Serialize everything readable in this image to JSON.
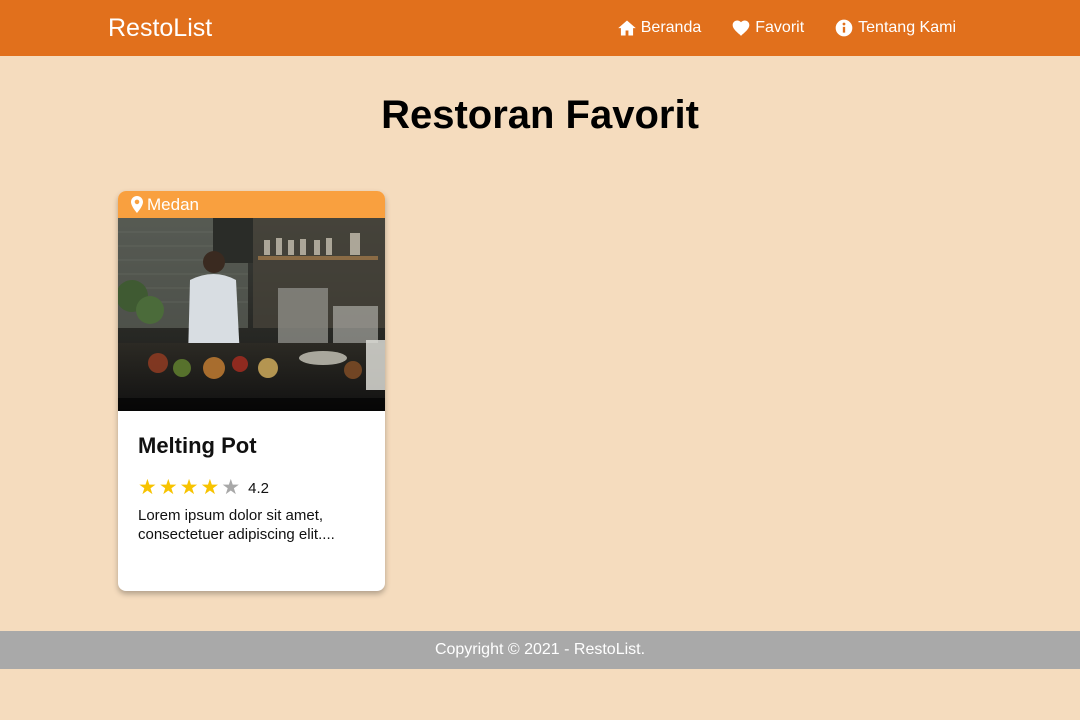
{
  "header": {
    "brand": "RestoList",
    "nav": [
      {
        "label": "Beranda",
        "icon": "home-icon"
      },
      {
        "label": "Favorit",
        "icon": "heart-icon"
      },
      {
        "label": "Tentang Kami",
        "icon": "info-icon"
      }
    ]
  },
  "main": {
    "title": "Restoran Favorit",
    "restaurants": [
      {
        "city": "Medan",
        "name": "Melting Pot",
        "rating": 4.2,
        "rating_text": "4.2",
        "stars_filled": 4,
        "stars_total": 5,
        "description": "Lorem ipsum dolor sit amet, consectetuer adipiscing elit...."
      }
    ]
  },
  "footer": {
    "copyright": "Copyright © 2021 - RestoList."
  },
  "colors": {
    "header_bg": "#e1701c",
    "page_bg": "#f5dcbe",
    "city_tag_bg": "#f9a03f",
    "star_on": "#f7c300",
    "star_off": "#a8a8a8",
    "footer_bg": "#a9a9a9"
  }
}
